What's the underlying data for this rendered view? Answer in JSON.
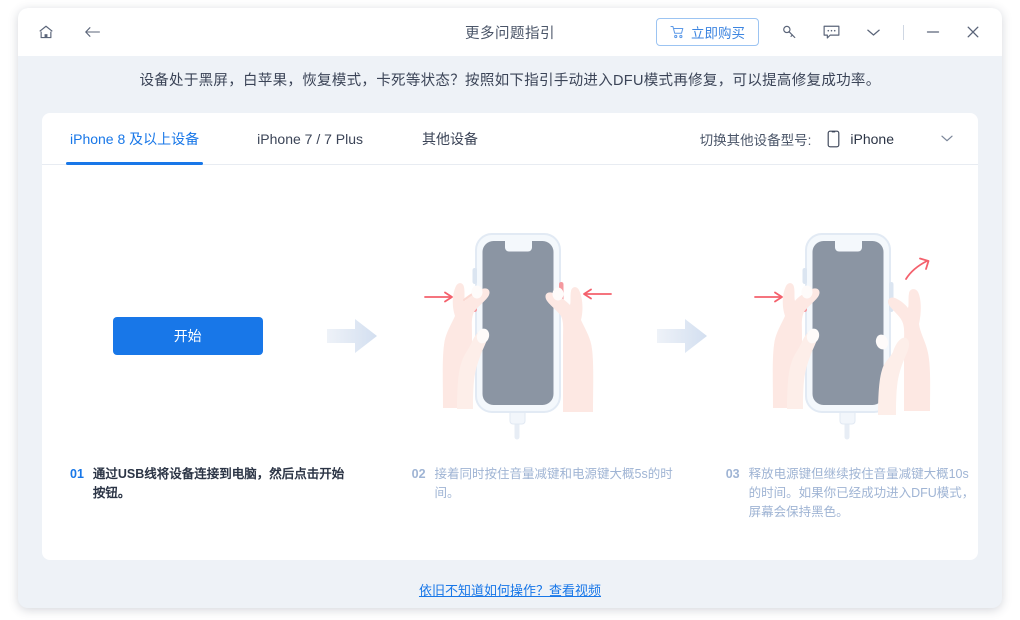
{
  "window": {
    "title": "更多问题指引",
    "home_icon": "home-icon",
    "back_icon": "back-arrow-icon"
  },
  "toolbar": {
    "buy_label": "立即购买",
    "cart_icon": "cart-icon",
    "account_icon": "key-icon",
    "feedback_icon": "chat-bubble-icon",
    "more_icon": "chevron-down-icon",
    "minimize_icon": "minimize-icon",
    "close_icon": "close-icon"
  },
  "banner": {
    "text": "设备处于黑屏，白苹果，恢复模式，卡死等状态？按照如下指引手动进入DFU模式再修复，可以提高修复成功率。"
  },
  "tabs": [
    {
      "label": "iPhone 8 及以上设备",
      "active": true
    },
    {
      "label": "iPhone 7 / 7 Plus",
      "active": false
    },
    {
      "label": "其他设备",
      "active": false
    }
  ],
  "model_select": {
    "label": "切换其他设备型号:",
    "value": "iPhone",
    "device_icon": "phone-icon",
    "caret_icon": "chevron-down-icon"
  },
  "steps": [
    {
      "num": "01",
      "text": "通过USB线将设备连接到电脑，然后点击开始按钮。",
      "action_label": "开始"
    },
    {
      "num": "02",
      "text": "接着同时按住音量减键和电源键大概5s的时间。"
    },
    {
      "num": "03",
      "text": "释放电源键但继续按住音量减键大概10s的时间。如果你已经成功进入DFU模式，屏幕会保持黑色。"
    }
  ],
  "footer": {
    "link_text": "依旧不知道如何操作？查看视频"
  },
  "colors": {
    "accent": "#1877e8",
    "app_bg": "#eef2f7",
    "card_bg": "#ffffff",
    "muted_text": "#9fb4d4",
    "arrow_red": "#f4737b"
  }
}
